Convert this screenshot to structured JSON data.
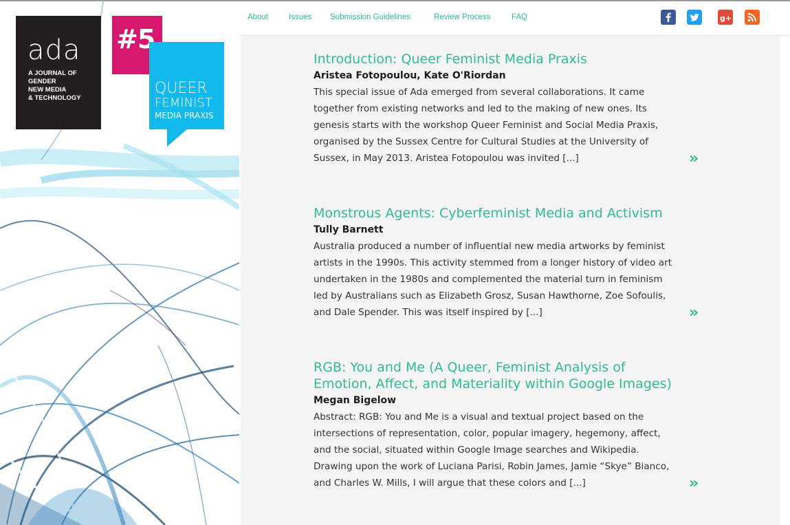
{
  "logo": {
    "word": "ada",
    "tagline": "A JOURNAL OF\nGENDER\nNEW MEDIA\n& TECHNOLOGY"
  },
  "issue": {
    "number": "#5",
    "topic_line_1": "QUEER",
    "topic_line_2": "FEMINIST",
    "topic_line_3": "MEDIA PRAXIS"
  },
  "nav": {
    "items": [
      "About",
      "Issues",
      "Submission Guidelines",
      "Review Process",
      "FAQ"
    ]
  },
  "social": [
    {
      "icon": "facebook-icon",
      "color": "#3b5998"
    },
    {
      "icon": "twitter-icon",
      "color": "#1da1f2"
    },
    {
      "icon": "google-plus-icon",
      "color": "#dd4b39"
    },
    {
      "icon": "rss-icon",
      "color": "#f26522"
    }
  ],
  "colors": {
    "accent": "#2fba98",
    "logo_bg": "#231f20",
    "issue_badge": "#d6176f",
    "topic_badge": "#12b9ea"
  },
  "articles": [
    {
      "title": "Introduction: Queer Feminist Media Praxis",
      "authors": "Aristea Fotopoulou, Kate O'Riordan",
      "excerpt": [
        "This special issue of Ada emerged from several collaborations. It came",
        "together from existing networks and led to the making of new ones. Its",
        "genesis starts with the workshop Queer Feminist and Social Media Praxis,",
        "organised by the Sussex Centre for Cultural Studies at the University of",
        "Sussex, in May 2013. Aristea Fotopoulou was invited [...]"
      ],
      "more": "»"
    },
    {
      "title": "Monstrous Agents: Cyberfeminist Media and Activism",
      "authors": "Tully Barnett",
      "excerpt": [
        "Australia produced a number of influential new media artworks by feminist",
        "artists in the 1990s. This activity stemmed from a longer history of video art",
        "undertaken in the 1980s and complemented the material turn in feminism",
        "led by Australians such as Elizabeth Grosz, Susan Hawthorne, Zoe Sofoulis,",
        "and Dale Spender. This was itself inspired by [...]"
      ],
      "more": "»"
    },
    {
      "title_lines": [
        "RGB: You and Me (A Queer, Feminist Analysis of",
        "Emotion, Affect, and Materiality within Google Images)"
      ],
      "authors": "Megan Bigelow",
      "excerpt": [
        "Abstract: RGB: You and Me is a visual and textual project based on the",
        "intersections of representation, color, popular imagery, hegemony, affect,",
        "and the social, situated within Google Image searches and Wikipedia.",
        "Drawing upon the work of Luciana Parisi, Robin James, Jamie “Skye” Bianco,",
        "and Charles W. Mills, I will argue that these colors and [...]"
      ],
      "more": "»"
    }
  ]
}
